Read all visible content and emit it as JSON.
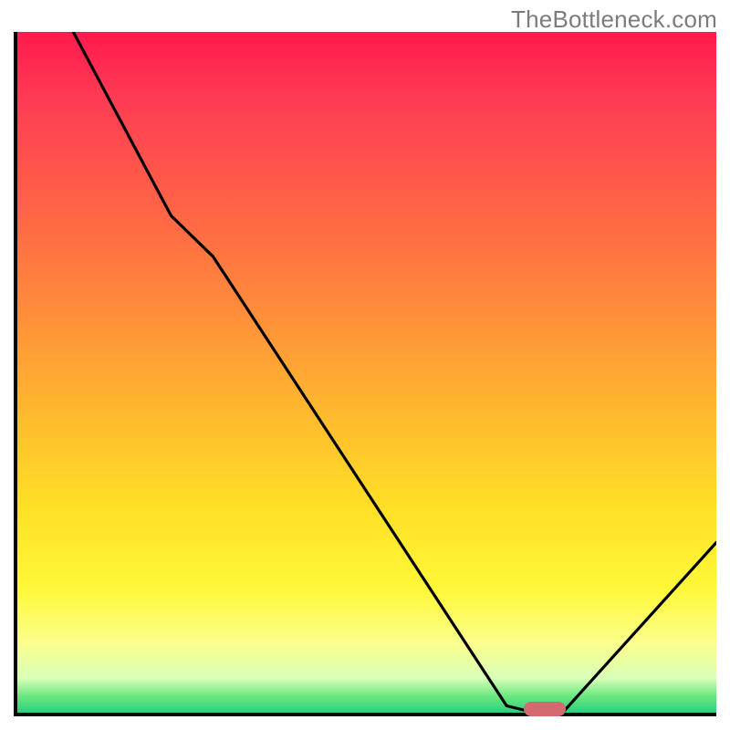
{
  "watermark": "TheBottleneck.com",
  "chart_data": {
    "type": "line",
    "title": "",
    "xlabel": "",
    "ylabel": "",
    "xlim": [
      0,
      100
    ],
    "ylim": [
      0,
      100
    ],
    "grid": false,
    "series": [
      {
        "name": "bottleneck-curve",
        "color": "#000000",
        "x": [
          8,
          22,
          28,
          70,
          74,
          78,
          100
        ],
        "values": [
          100,
          73,
          67,
          1,
          0,
          0,
          25
        ]
      }
    ],
    "annotations": [
      {
        "name": "optimal-marker",
        "shape": "rounded-rect",
        "x": 75.5,
        "y": 0.5,
        "color": "#d46a70"
      }
    ],
    "background_gradient": {
      "direction": "vertical",
      "stops": [
        {
          "pos": 0.0,
          "color": "#ff1a4d"
        },
        {
          "pos": 0.25,
          "color": "#ff6147"
        },
        {
          "pos": 0.55,
          "color": "#ffb62f"
        },
        {
          "pos": 0.82,
          "color": "#fff83a"
        },
        {
          "pos": 0.95,
          "color": "#d8ffb8"
        },
        {
          "pos": 1.0,
          "color": "#29d07e"
        }
      ]
    }
  }
}
